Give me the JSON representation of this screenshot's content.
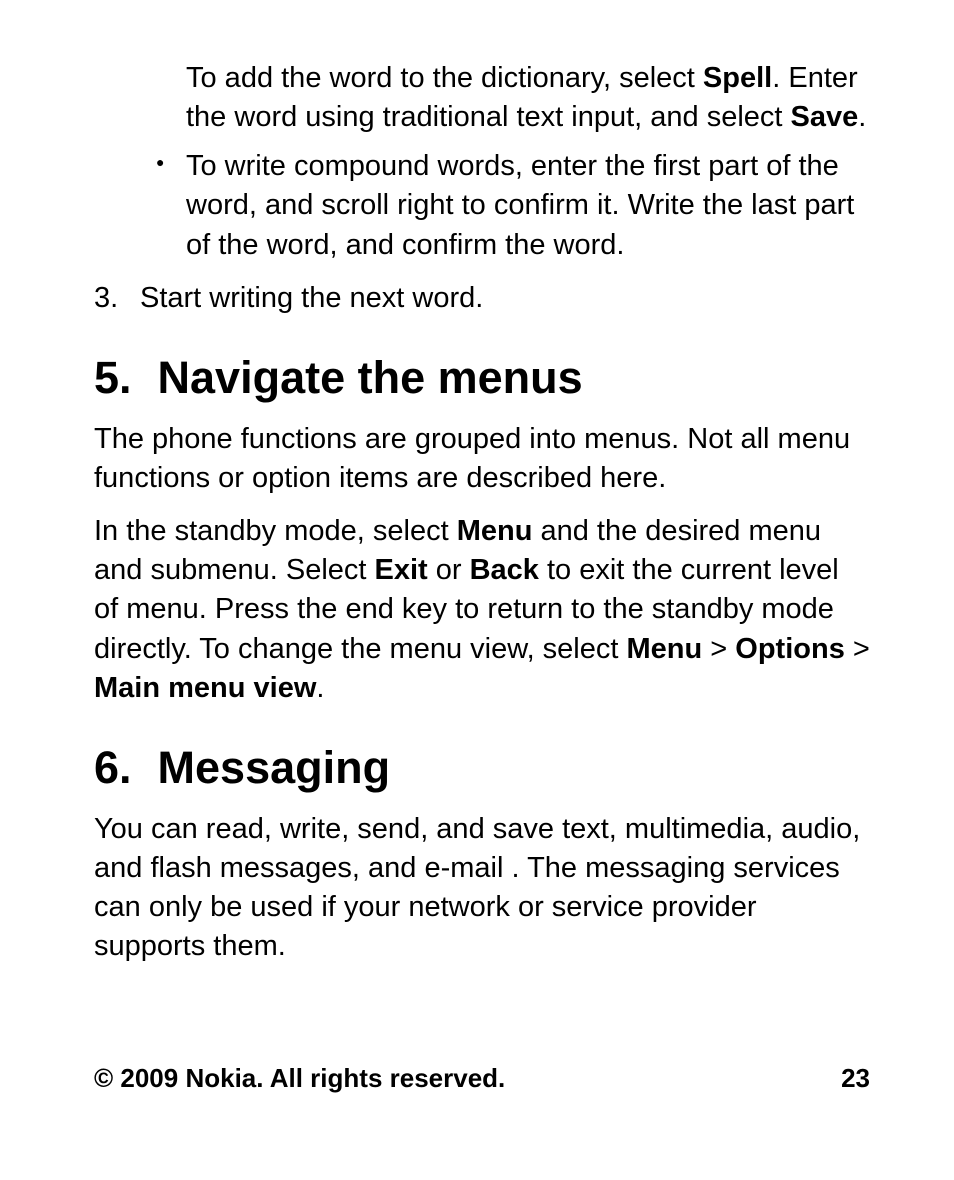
{
  "top_paragraph": {
    "t1": "To add the word to the dictionary, select ",
    "b1": "Spell",
    "t2": ". Enter the word using traditional text input, and select ",
    "b2": "Save",
    "t3": "."
  },
  "bullet2": "To write compound words, enter the first part of the word, and scroll right to confirm it. Write the last part of the word, and confirm the word.",
  "step3_num": "3.",
  "step3_text": "Start writing the next word.",
  "section5_num": "5.",
  "section5_title": "Navigate the menus",
  "section5_p1": "The phone functions are grouped into menus. Not all menu functions or option items are described here.",
  "section5_p2": {
    "t1": "In the standby mode, select ",
    "b1": "Menu",
    "t2": " and the desired menu and submenu. Select ",
    "b2": "Exit",
    "t3": " or ",
    "b3": "Back",
    "t4": " to exit the current level of menu. Press the end key to return to the standby mode directly. To change the menu view, select ",
    "b4": "Menu",
    "t5": " > ",
    "b5": "Options",
    "t6": " > ",
    "b6": "Main menu view",
    "t7": "."
  },
  "section6_num": "6.",
  "section6_title": "Messaging",
  "section6_p1": "You can read, write, send, and save text, multimedia, audio, and flash messages, and e-mail . The messaging services can only be used if your network or service provider supports them.",
  "footer_left": "© 2009 Nokia. All rights reserved.",
  "footer_right": "23"
}
